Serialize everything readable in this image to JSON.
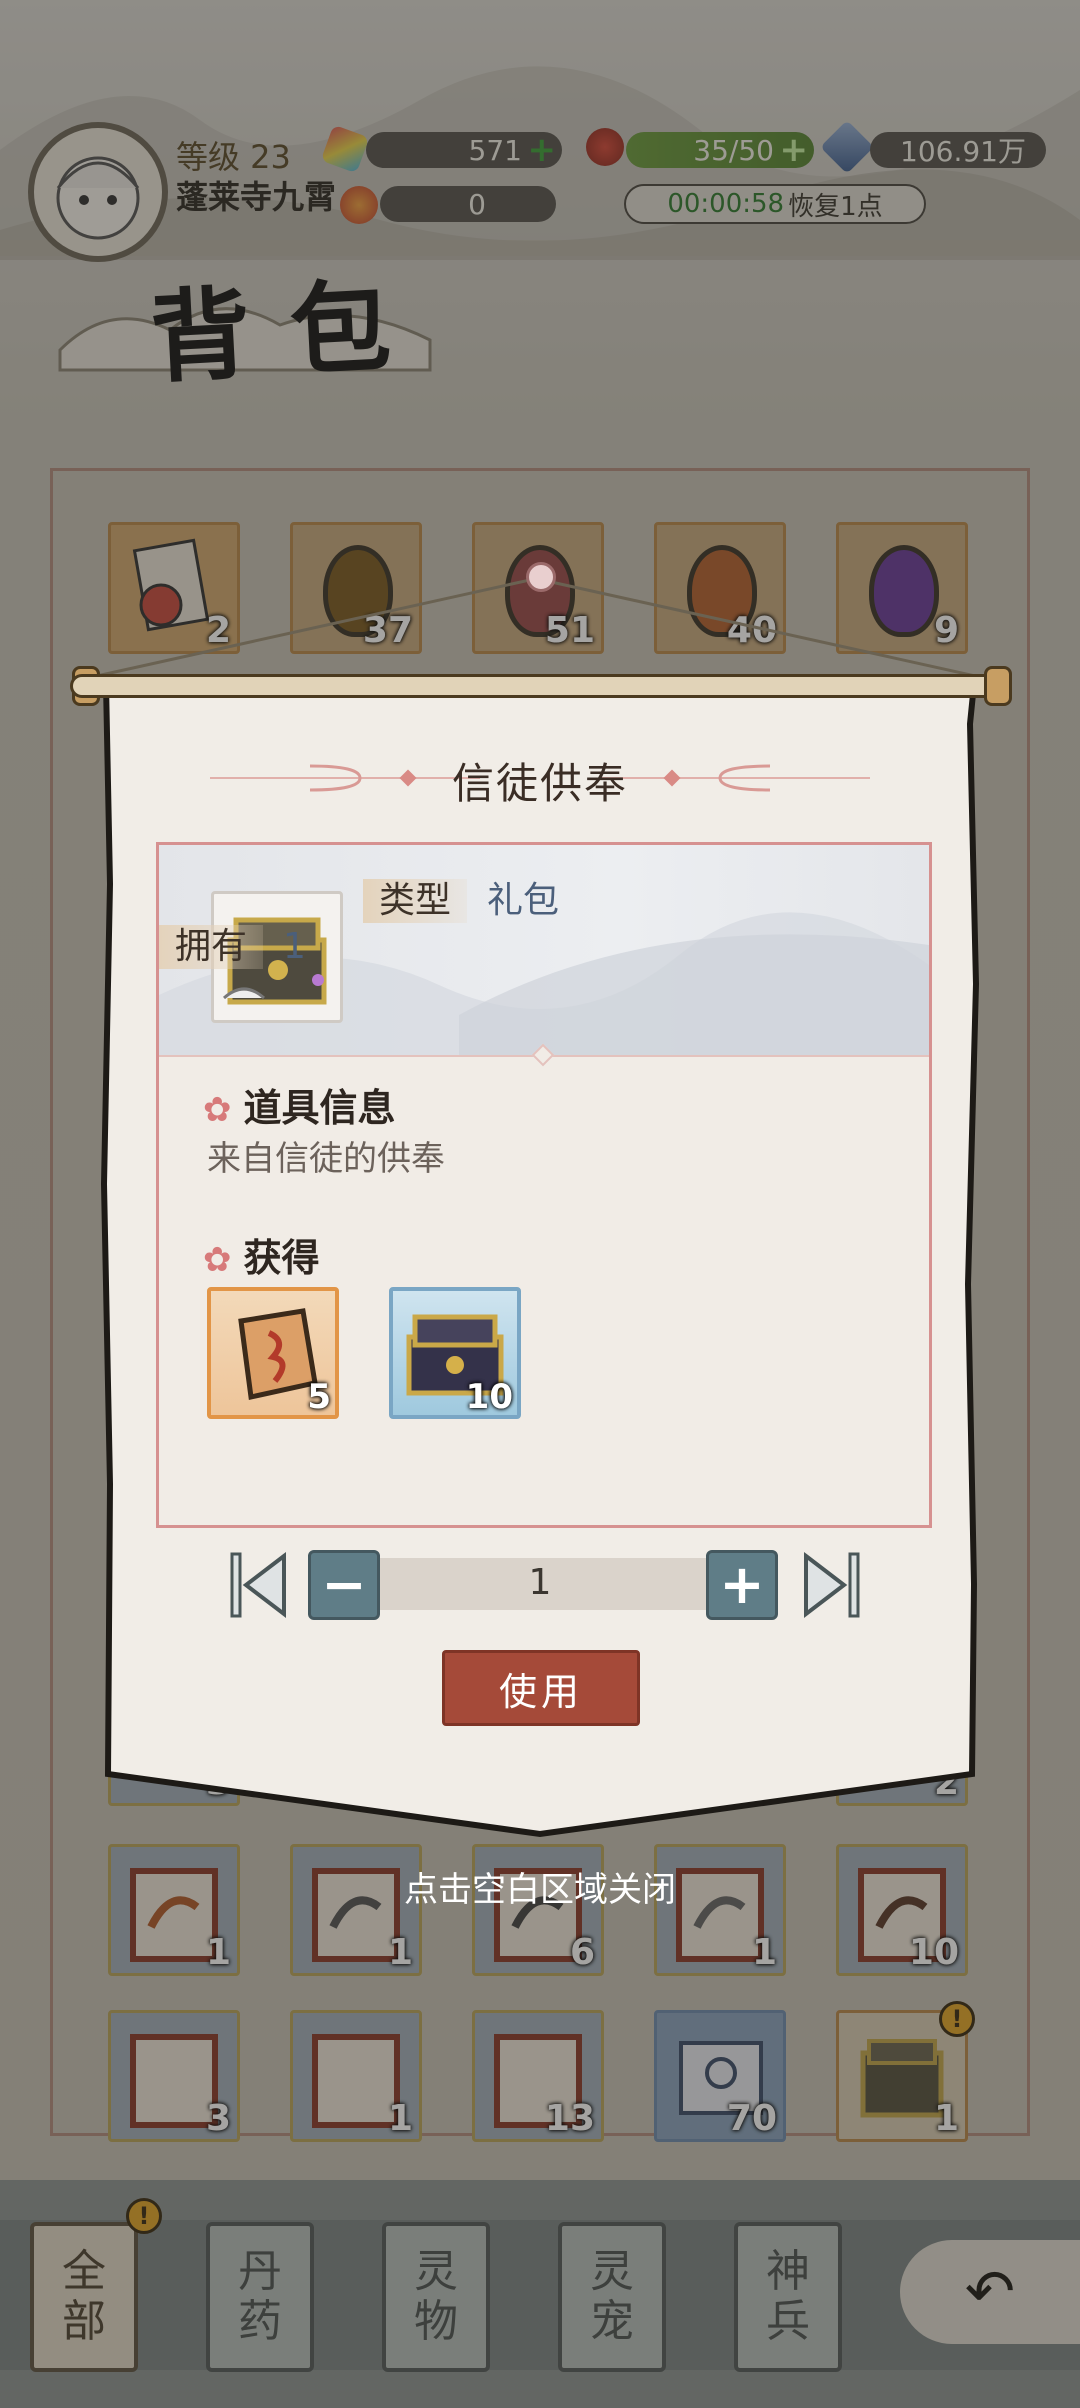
{
  "hud": {
    "level": "等级 23",
    "username": "蓬莱寺九霄",
    "gems": "571",
    "coins2": "0",
    "stamina": "35/50",
    "crystals": "106.91万",
    "timer_time": "00:00:58",
    "timer_text": "恢复1点"
  },
  "page_title": "背包",
  "inventory": {
    "top_row_counts": [
      "2",
      "37",
      "51",
      "40",
      "9"
    ],
    "row_a_counts": [
      "1",
      "1",
      "6",
      "1",
      "10"
    ],
    "row_b_counts": [
      "3",
      "1",
      "13",
      "70",
      "1"
    ],
    "hidden_row_counts": [
      "3",
      "2"
    ]
  },
  "popup": {
    "title": "信徒供奉",
    "type_label": "类型",
    "type_value": "礼包",
    "own_label": "拥有",
    "own_value": "1",
    "info_title": "道具信息",
    "info_desc": "来自信徒的供奉",
    "obtain_title": "获得",
    "rewards": [
      {
        "count": "5",
        "icon": "token-icon"
      },
      {
        "count": "10",
        "icon": "chest-icon"
      }
    ],
    "quantity": "1",
    "use_label": "使用",
    "close_hint": "点击空白区域关闭"
  },
  "nav": {
    "tabs": [
      "全部",
      "丹药",
      "灵物",
      "灵宠",
      "神兵"
    ],
    "badge": "!"
  },
  "colors": {
    "use_button": "#a54a39",
    "stepper": "#5f7d87",
    "info_border": "#d69190"
  }
}
